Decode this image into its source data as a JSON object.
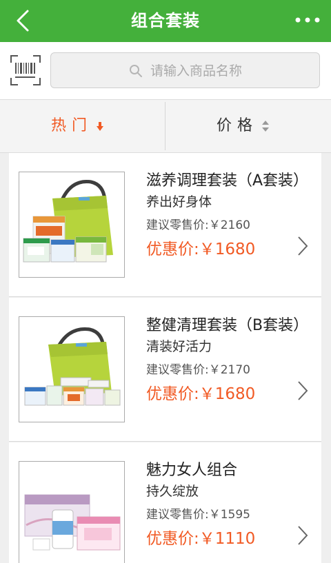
{
  "header": {
    "title": "组合套装",
    "back_icon": "chevron-left-icon",
    "more_icon": "more-dots-icon"
  },
  "search": {
    "placeholder": "请输入商品名称",
    "scan_icon": "barcode-scan-icon",
    "search_icon": "search-icon"
  },
  "sort": {
    "hot_label": "热门",
    "price_label": "价格"
  },
  "colors": {
    "brand_green": "#44b03b",
    "accent_orange": "#f15a24"
  },
  "products": [
    {
      "name": "滋养调理套装（A套装）",
      "subtitle": "养出好身体",
      "retail": "建议零售价:￥2160",
      "price": "优惠价:￥1680"
    },
    {
      "name": "整健清理套装（B套装）",
      "subtitle": "清装好活力",
      "retail": "建议零售价:￥2170",
      "price": "优惠价:￥1680"
    },
    {
      "name": "魅力女人组合",
      "subtitle": "持久绽放",
      "retail": "建议零售价:￥1595",
      "price": "优惠价:￥1110"
    }
  ]
}
